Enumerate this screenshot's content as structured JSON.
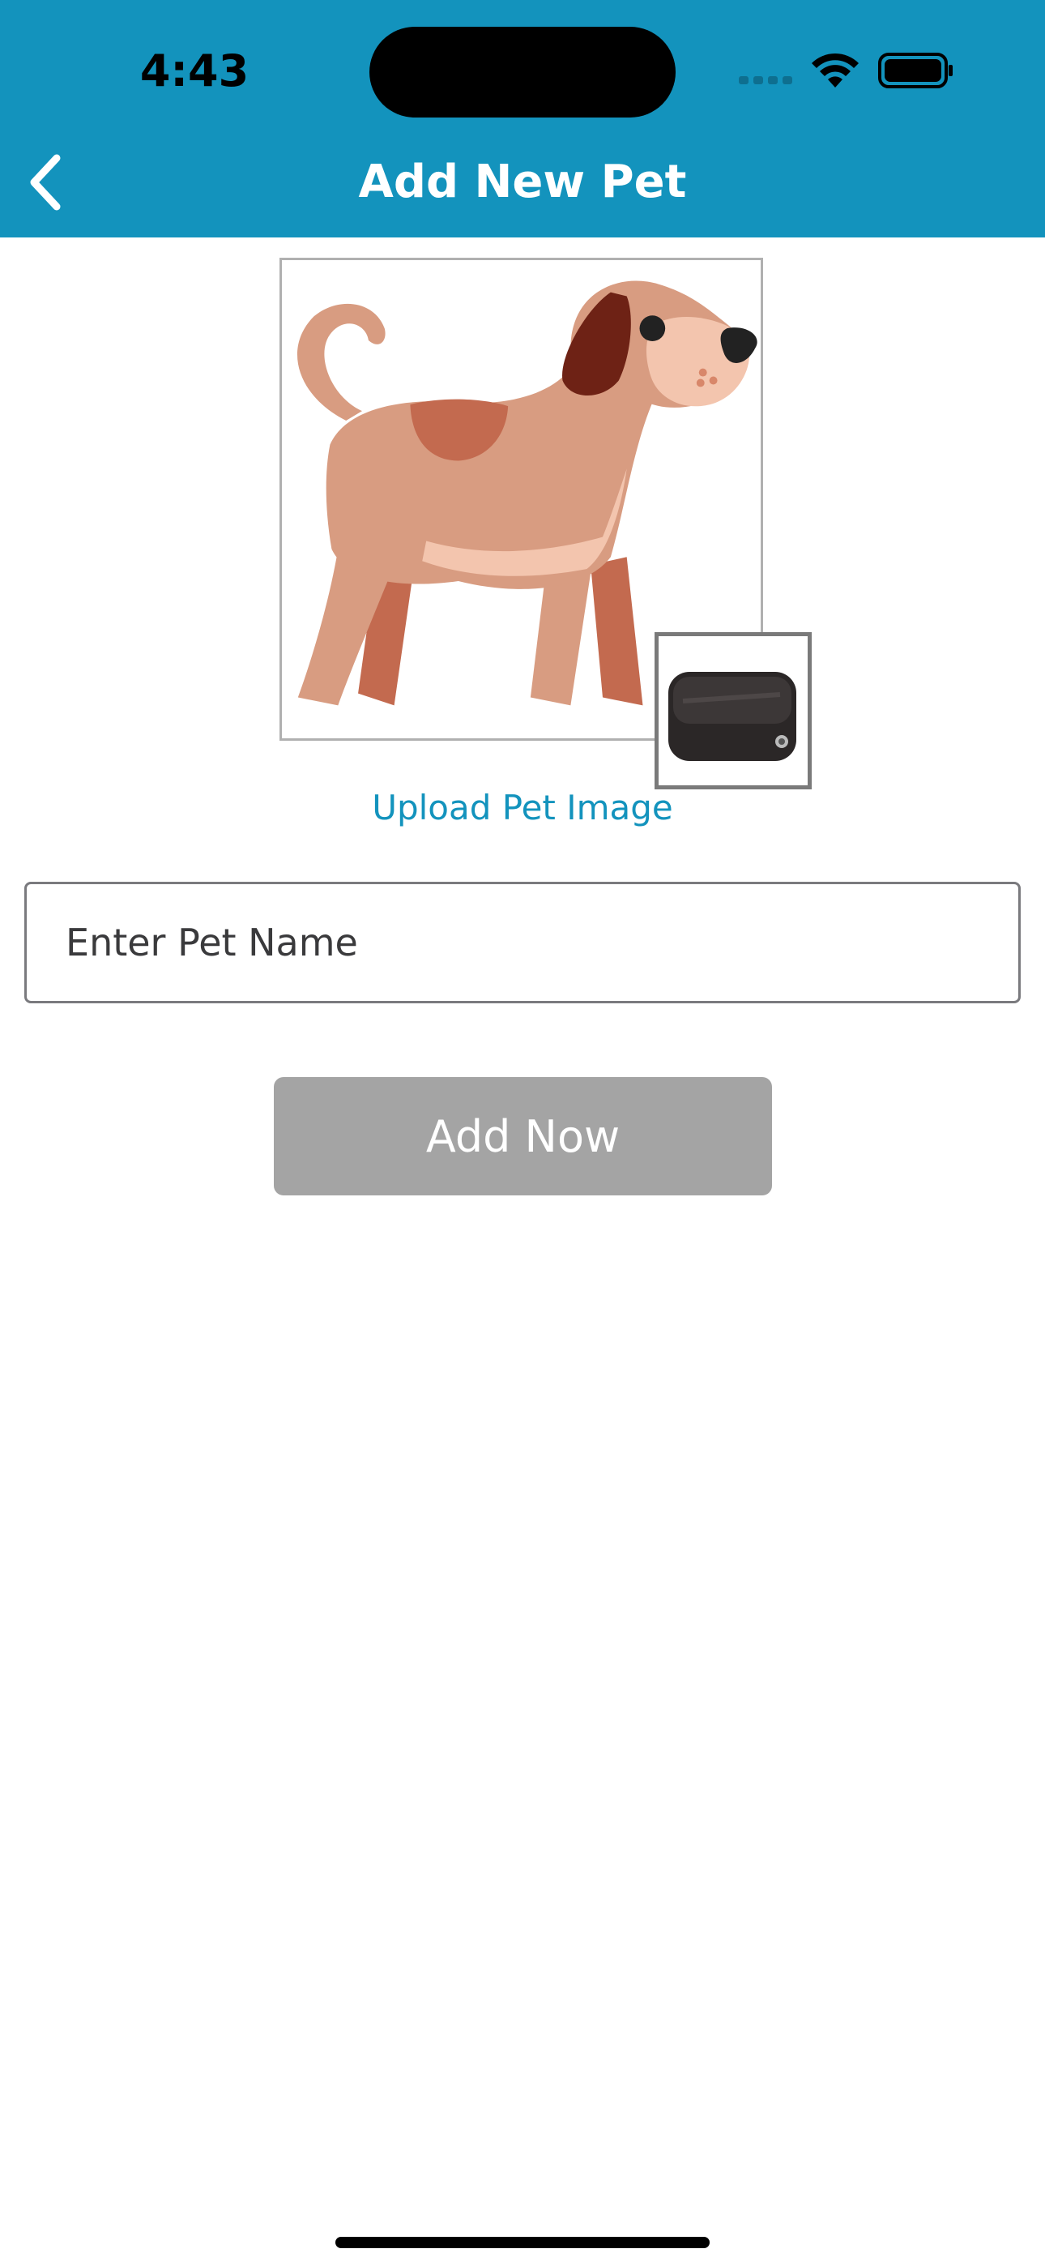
{
  "status_bar": {
    "time": "4:43",
    "icons": [
      "signal-icon",
      "wifi-icon",
      "battery-icon"
    ]
  },
  "header": {
    "title": "Add New Pet",
    "back_icon": "chevron-left-icon",
    "background_color": "#1393BD"
  },
  "pet_image": {
    "icon": "dog-illustration"
  },
  "device_thumbnail": {
    "icon": "tracker-device"
  },
  "upload": {
    "label": "Upload Pet Image"
  },
  "form": {
    "name_placeholder": "Enter Pet Name",
    "name_value": ""
  },
  "actions": {
    "add_label": "Add Now",
    "add_color": "#A4A4A4"
  }
}
